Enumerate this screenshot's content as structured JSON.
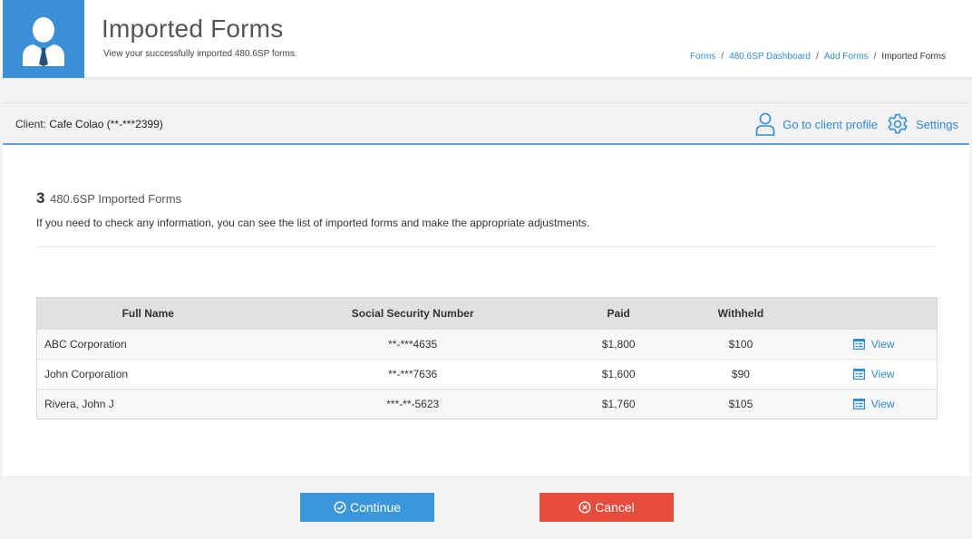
{
  "header": {
    "title": "Imported Forms",
    "subtitle": "View your successfully imported 480.6SP forms.",
    "breadcrumb": [
      "Forms",
      "480.6SP Dashboard",
      "Add Forms",
      "Imported Forms"
    ]
  },
  "client_bar": {
    "label": "Client:",
    "client_name": "Cafe Colao (**-***2399)",
    "profile_link": "Go to client profile",
    "settings_link": "Settings"
  },
  "summary": {
    "count": "3",
    "count_label": "480.6SP Imported Forms",
    "info": "If you need to check any information, you can see the list of imported forms and make the appropriate adjustments."
  },
  "table": {
    "headers": [
      "Full Name",
      "Social Security Number",
      "Paid",
      "Withheld",
      ""
    ],
    "rows": [
      {
        "name": "ABC Corporation",
        "ssn": "**-***4635",
        "paid": "$1,800",
        "withheld": "$100",
        "action": "View"
      },
      {
        "name": "John Corporation",
        "ssn": "**-***7636",
        "paid": "$1,600",
        "withheld": "$90",
        "action": "View"
      },
      {
        "name": "Rivera, John J",
        "ssn": "***-**-5623",
        "paid": "$1,760",
        "withheld": "$105",
        "action": "View"
      }
    ]
  },
  "footer": {
    "continue_label": "Continue",
    "cancel_label": "Cancel"
  },
  "colors": {
    "accent": "#2e8bd8",
    "header_avatar_bg": "#3a8fd6",
    "continue_bg": "#3a97dc",
    "cancel_bg": "#e84c3d"
  },
  "icons": {
    "header_avatar": "businessman-avatar-icon",
    "profile": "user-icon",
    "settings": "gear-icon",
    "view": "document-list-icon",
    "continue": "check-circle-icon",
    "cancel": "close-circle-icon"
  }
}
